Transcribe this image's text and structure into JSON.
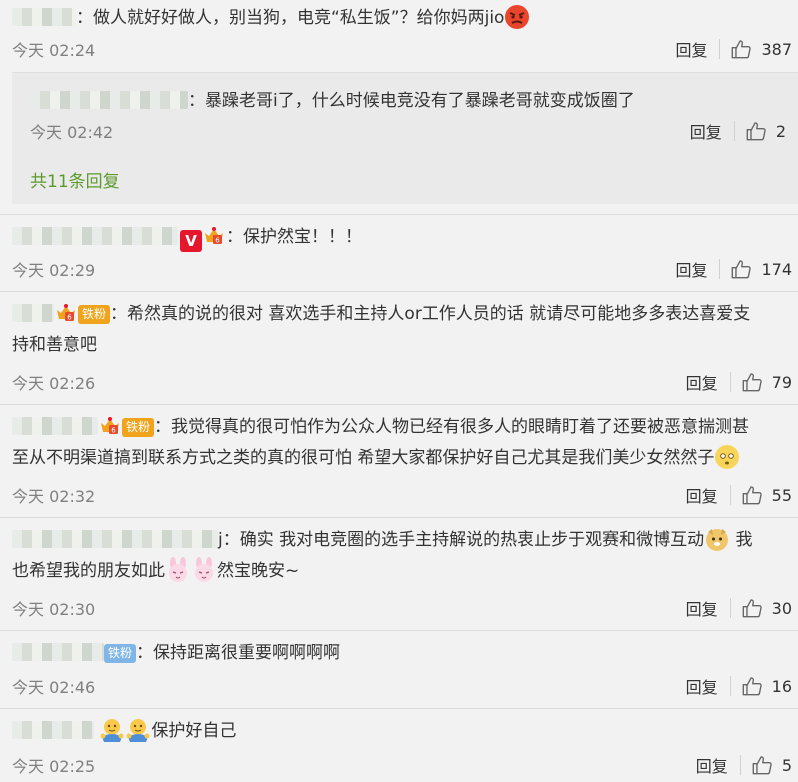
{
  "comments": [
    {
      "text": "：做人就好好做人，别当狗，电竞“私生饭”？给你妈两jio",
      "time": "今天 02:24",
      "reply_label": "回复",
      "likes": "387",
      "sub_reply": {
        "text": "：暴躁老哥i了，什么时候电竞没有了暴躁老哥就变成饭圈了",
        "time": "今天 02:42",
        "reply_label": "回复",
        "likes": "2"
      },
      "more_replies": "共11条回复"
    },
    {
      "text": "：保护然宝！！！",
      "time": "今天 02:29",
      "reply_label": "回复",
      "likes": "174"
    },
    {
      "badge": "铁粉",
      "text_line1": "：希然真的说的很对 喜欢选手和主持人or工作人员的话 就请尽可能地多多表达喜爱支",
      "text_line2": "持和善意吧",
      "time": "今天 02:26",
      "reply_label": "回复",
      "likes": "79"
    },
    {
      "badge": "铁粉",
      "text_line1": "：我觉得真的很可怕作为公众人物已经有很多人的眼睛盯着了还要被恶意揣测甚",
      "text_line2": "至从不明渠道搞到联系方式之类的真的很可怕 希望大家都保护好自己尤其是我们美少女然然子",
      "time": "今天 02:32",
      "reply_label": "回复",
      "likes": "55"
    },
    {
      "name_tail": "j",
      "text_line1": "：确实 我对电竞圈的选手主持解说的热衷止步于观赛和微博互动",
      "text_line1_after": " 我",
      "text_line2_before": "也希望我的朋友如此",
      "text_line2_after": "然宝晚安~",
      "time": "今天 02:30",
      "reply_label": "回复",
      "likes": "30"
    },
    {
      "badge": "铁粉",
      "text": "：保持距离很重要啊啊啊啊",
      "time": "今天 02:46",
      "reply_label": "回复",
      "likes": "16"
    },
    {
      "text": "保护好自己",
      "time": "今天 02:25",
      "reply_label": "回复",
      "likes": "5"
    }
  ],
  "icons": {
    "like": "thumbs-up-icon",
    "angry": "angry-face-emoji",
    "shy": "flushed-face-emoji",
    "dog": "doge-emoji",
    "bunny": "bunny-emoji",
    "hug": "hug-emoji",
    "vip": "v-badge-icon",
    "crown": "fan-crown-icon"
  },
  "colors": {
    "link_green": "#5d9a2d",
    "badge_gold": "#f0a31c",
    "badge_blue": "#7fb6e6",
    "vip_red": "#e6162d"
  }
}
